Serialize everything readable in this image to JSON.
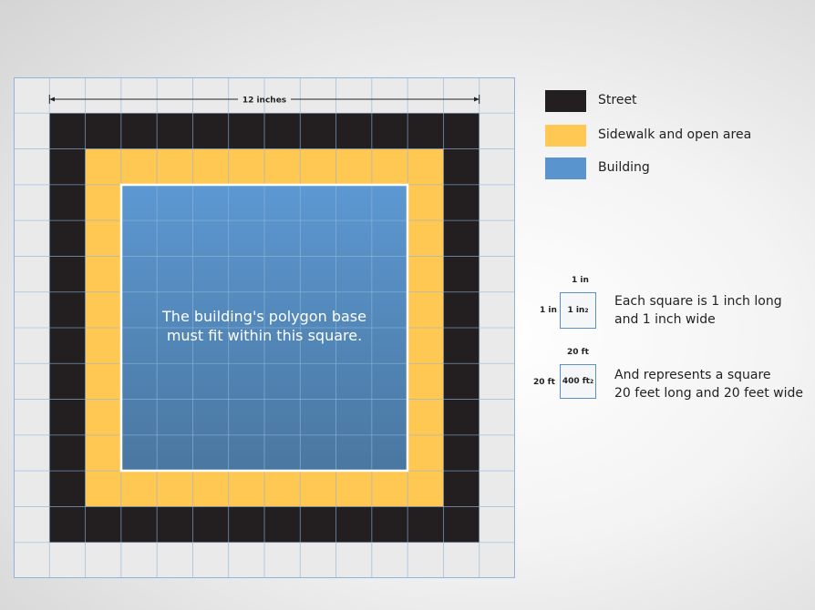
{
  "diagram": {
    "dimension_label": "12 inches",
    "building_caption": {
      "line1": "The building's polygon base",
      "line2": "must fit within this square."
    },
    "grid": {
      "columns": 14,
      "rows": 14,
      "line_color": "#8fb5db"
    }
  },
  "legend": {
    "items": [
      {
        "label": "Street",
        "color": "#231f20"
      },
      {
        "label": "Sidewalk and open area",
        "color": "#ffc853"
      },
      {
        "label": "Building",
        "color": "#5a94cf"
      }
    ]
  },
  "scale": {
    "inch": {
      "top_label": "1 in",
      "side_label": "1 in",
      "box_value": "1 in",
      "box_exponent": "2",
      "description_line1": "Each square is 1 inch long",
      "description_line2": "and 1 inch wide"
    },
    "feet": {
      "top_label": "20 ft",
      "side_label": "20 ft",
      "box_value": "400 ft",
      "box_exponent": "2",
      "description_line1": "And represents a square",
      "description_line2": "20 feet long and 20 feet wide"
    }
  },
  "colors": {
    "street": "#231f20",
    "sidewalk": "#ffc853",
    "building_top": "#5c98d2",
    "building_bottom": "#4a77a0",
    "outer": "#eaeaea"
  }
}
